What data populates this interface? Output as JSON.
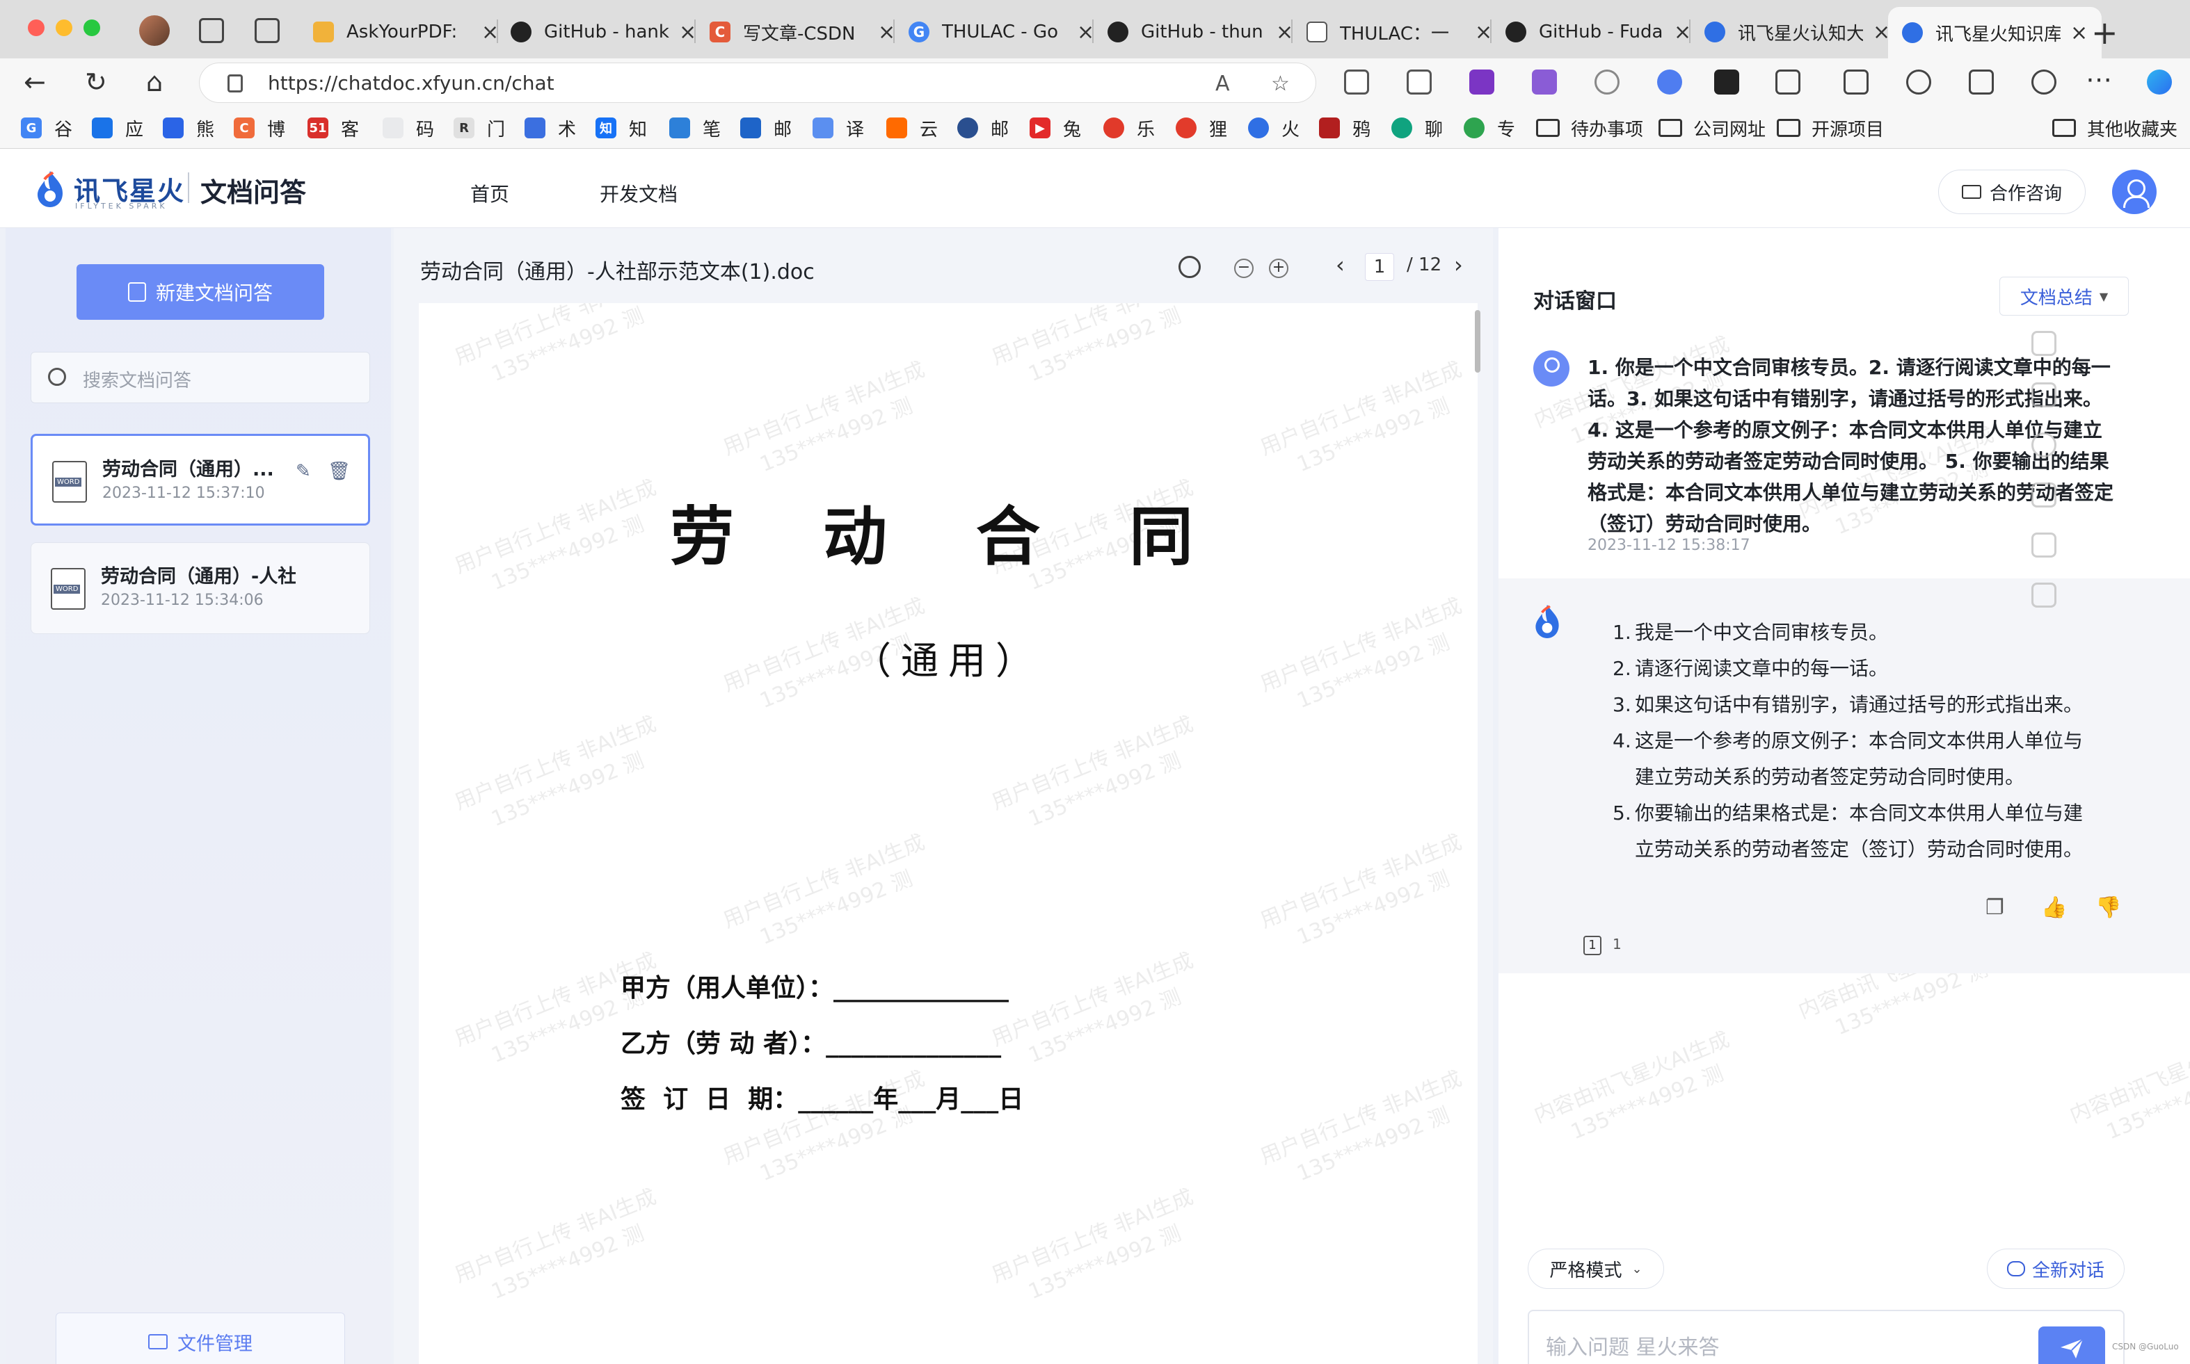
{
  "browser": {
    "tabs": [
      {
        "label": "AskYourPDF:",
        "icon": "askyourpdf-icon",
        "color": "#f1b23a"
      },
      {
        "label": "GitHub - hank",
        "icon": "github-icon",
        "color": "#222222"
      },
      {
        "label": "写文章-CSDN",
        "icon": "csdn-icon",
        "color": "#e45b3a"
      },
      {
        "label": "THULAC - Go",
        "icon": "google-icon",
        "color": "#4285f4"
      },
      {
        "label": "GitHub - thun",
        "icon": "github-icon",
        "color": "#222222"
      },
      {
        "label": "THULAC：一",
        "icon": "document-icon",
        "color": "#888888"
      },
      {
        "label": "GitHub - Fuda",
        "icon": "github-icon",
        "color": "#222222"
      },
      {
        "label": "讯飞星火认知大",
        "icon": "spark-icon",
        "color": "#2f6fe4"
      },
      {
        "label": "讯飞星火知识库",
        "icon": "spark-icon",
        "color": "#2f6fe4",
        "active": true
      }
    ],
    "url": "https://chatdoc.xfyun.cn/chat",
    "bookmarks": [
      {
        "label": "谷",
        "bg": "#4285f4"
      },
      {
        "label": "应",
        "bg": "#1a73e8"
      },
      {
        "label": "熊",
        "bg": "#2b64e6"
      },
      {
        "label": "博",
        "bg": "#f06b3b"
      },
      {
        "label": "客",
        "bg": "#d9302c"
      },
      {
        "label": "码",
        "bg": "#e9eaec"
      },
      {
        "label": "门",
        "bg": "#e0e0e0"
      },
      {
        "label": "术",
        "bg": "#3b6fe0"
      },
      {
        "label": "知",
        "bg": "#1772f6"
      },
      {
        "label": "笔",
        "bg": "#2d80d9"
      },
      {
        "label": "邮",
        "bg": "#1e64c8"
      },
      {
        "label": "译",
        "bg": "#5b8ff0"
      },
      {
        "label": "云",
        "bg": "#ff6a00"
      },
      {
        "label": "邮",
        "bg": "#2a4f8f"
      },
      {
        "label": "兔",
        "bg": "#e32a2a"
      },
      {
        "label": "乐",
        "bg": "#e13a2a"
      },
      {
        "label": "狸",
        "bg": "#e23b2b"
      },
      {
        "label": "火",
        "bg": "#2f6fe4"
      },
      {
        "label": "鸦",
        "bg": "#b21f1f"
      },
      {
        "label": "聊",
        "bg": "#10a37f"
      },
      {
        "label": "专",
        "bg": "#2ea44f"
      }
    ],
    "folders": [
      "待办事项",
      "公司网址",
      "开源项目"
    ],
    "other_bookmarks": "其他收藏夹"
  },
  "app": {
    "logo_text": "讯飞星火",
    "logo_sub": "IFLYTEK SPARK",
    "product": "文档问答",
    "nav": [
      "首页",
      "开发文档"
    ],
    "consult": "合作咨询"
  },
  "sidebar": {
    "new_button": "新建文档问答",
    "search_placeholder": "搜索文档问答",
    "docs": [
      {
        "title": "劳动合同（通用）...",
        "time": "2023-11-12 15:37:10",
        "badge": "WORD"
      },
      {
        "title": "劳动合同（通用）-人社...",
        "time": "2023-11-12 15:34:06",
        "badge": "WORD"
      }
    ],
    "files_button": "文件管理"
  },
  "viewer": {
    "file_name": "劳动合同（通用）-人社部示范文本(1).doc",
    "page_current": "1",
    "page_total": "/ 12",
    "zoom_out": "−",
    "zoom_in": "+",
    "prev": "‹",
    "next": "›",
    "doc_title": "劳 动 合 同",
    "doc_subtitle": "（通用）",
    "line_a": "甲方（用人单位）：______________",
    "line_b": "乙方（劳 动 者）：______________",
    "line_c": "签  订  日  期：______年___月___日",
    "watermark_line1": "用户自行上传 非AI生成",
    "watermark_line2": "135****4992 测",
    "watermark_chat1": "内容由讯飞星火AI生成",
    "watermark_chat2": "135****4992 测"
  },
  "chat": {
    "title": "对话窗口",
    "dropdown": "文档总结",
    "user_message": "1. 你是一个中文合同审核专员。2. 请逐行阅读文章中的每一话。3. 如果这句话中有错别字，请通过括号的形式指出来。4. 这是一个参考的原文例子：本合同文本供用人单位与建立劳动关系的劳动者签定劳动合同时使用。 5. 你要输出的结果格式是：本合同文本供用人单位与建立劳动关系的劳动者签定（签订）劳动合同时使用。",
    "user_time": "2023-11-12 15:38:17",
    "bot_items": [
      {
        "n": "1.",
        "text": "我是一个中文合同审核专员。"
      },
      {
        "n": "2.",
        "text": "请逐行阅读文章中的每一话。"
      },
      {
        "n": "3.",
        "text": "如果这句话中有错别字，请通过括号的形式指出来。"
      },
      {
        "n": "4.",
        "text": "这是一个参考的原文例子：本合同文本供用人单位与建立劳动关系的劳动者签定劳动合同时使用。"
      },
      {
        "n": "5.",
        "text": "你要输出的结果格式是：本合同文本供用人单位与建立劳动关系的劳动者签定（签订）劳动合同时使用。"
      }
    ],
    "ref_index": "1",
    "ref_count": "1",
    "mode": "严格模式",
    "new_chat": "全新对话",
    "input_placeholder": "输入问题 星火来答"
  },
  "footer_mark": "CSDN @GuoLuo"
}
